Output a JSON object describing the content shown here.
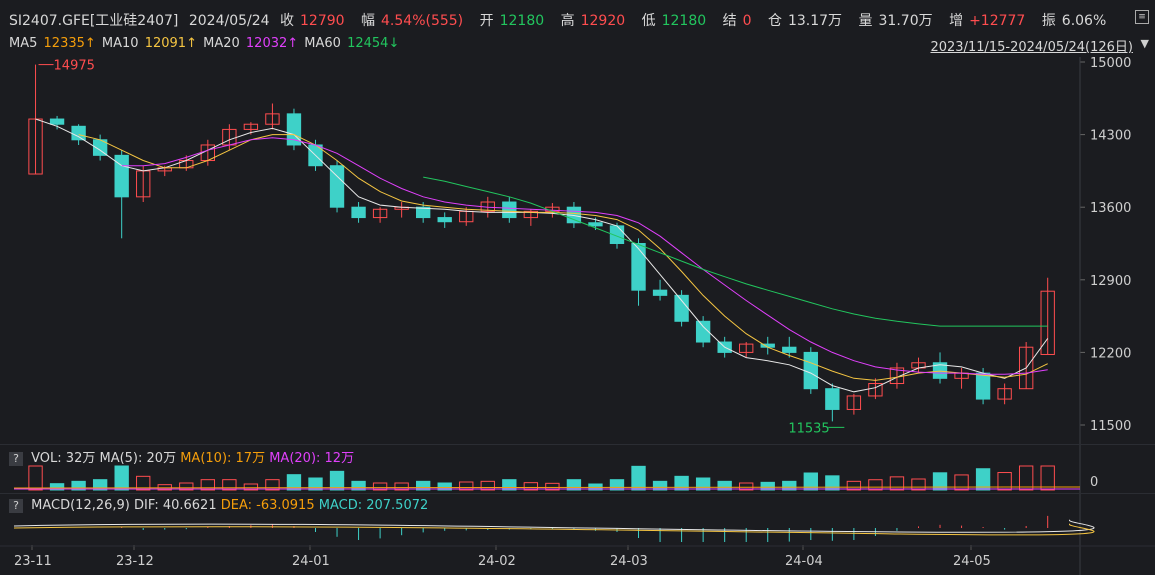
{
  "header": {
    "symbol": "SI2407.GFE[工业硅2407]",
    "date": "2024/05/24",
    "close_label": "收",
    "close": "12790",
    "change_label": "幅",
    "change": "4.54%(555)",
    "open_label": "开",
    "open": "12180",
    "high_label": "高",
    "high": "12920",
    "low_label": "低",
    "low": "12180",
    "settle_label": "结",
    "settle": "0",
    "oi_label": "仓",
    "oi": "13.17万",
    "volume_label": "量",
    "volume": "31.70万",
    "oi_change_label": "增",
    "oi_change": "+12777",
    "amplitude_label": "振",
    "amplitude": "6.06%"
  },
  "ma_row": {
    "ma5_label": "MA5",
    "ma5": "12335↑",
    "ma10_label": "MA10",
    "ma10": "12091↑",
    "ma20_label": "MA20",
    "ma20": "12032↑",
    "ma60_label": "MA60",
    "ma60": "12454↓"
  },
  "date_range": "2023/11/15-2024/05/24(126日)",
  "vol_panel": {
    "help": "?",
    "label": "VOL: 32万",
    "ma5": "MA(5): 20万",
    "ma10": "MA(10): 17万",
    "ma20": "MA(20): 12万",
    "axis_zero": "0"
  },
  "macd_panel": {
    "help": "?",
    "label": "MACD(12,26,9)",
    "dif": "DIF: 40.6621",
    "dea": "DEA: -63.0915",
    "macd": "MACD: 207.5072"
  },
  "annotations": {
    "high": "14975",
    "low": "11535"
  },
  "colors": {
    "up": "#ff4d4f",
    "down": "#3ed1c8",
    "ma5": "#e8e8e8",
    "ma10": "#f5c542",
    "ma20": "#e040fb",
    "ma60": "#22c55e"
  },
  "chart_data": {
    "type": "candlestick",
    "y_ticks": [
      "15000",
      "14300",
      "13600",
      "12900",
      "12200",
      "11500"
    ],
    "x_ticks": [
      "23-11",
      "23-12",
      "24-01",
      "24-02",
      "24-03",
      "24-04",
      "24-05"
    ],
    "ylim": [
      11500,
      15000
    ],
    "series": [
      {
        "name": "MA5",
        "values": [
          14450,
          14380,
          14280,
          14150,
          14000,
          13950,
          13980,
          14050,
          14150,
          14250,
          14320,
          14360,
          14300,
          14100,
          13900,
          13700,
          13620,
          13600,
          13590,
          13580,
          13560,
          13550,
          13550,
          13550,
          13540,
          13520,
          13480,
          13420,
          13200,
          12950,
          12700,
          12450,
          12250,
          12150,
          12120,
          12080,
          12000,
          11880,
          11820,
          11860,
          11960,
          12050,
          12080,
          12060,
          12000,
          11950,
          12050,
          12335
        ]
      },
      {
        "name": "MA10",
        "values": [
          null,
          null,
          14300,
          14250,
          14150,
          14050,
          13980,
          13980,
          14050,
          14150,
          14250,
          14300,
          14300,
          14200,
          14050,
          13880,
          13750,
          13660,
          13620,
          13600,
          13580,
          13570,
          13560,
          13550,
          13550,
          13540,
          13520,
          13480,
          13380,
          13200,
          12980,
          12750,
          12550,
          12380,
          12250,
          12170,
          12100,
          12020,
          11950,
          11930,
          11960,
          12000,
          12020,
          12000,
          11980,
          11960,
          11990,
          12091
        ]
      },
      {
        "name": "MA20",
        "values": [
          null,
          null,
          null,
          null,
          14000,
          14000,
          14020,
          14080,
          14150,
          14200,
          14250,
          14270,
          14250,
          14200,
          14120,
          14000,
          13880,
          13780,
          13700,
          13650,
          13620,
          13600,
          13590,
          13580,
          13570,
          13560,
          13550,
          13520,
          13450,
          13320,
          13160,
          13000,
          12850,
          12700,
          12560,
          12420,
          12300,
          12200,
          12120,
          12060,
          12030,
          12010,
          12000,
          12000,
          11990,
          11990,
          12000,
          12032
        ]
      },
      {
        "name": "MA60",
        "values": [
          null,
          null,
          null,
          null,
          null,
          null,
          null,
          null,
          null,
          null,
          null,
          null,
          null,
          null,
          null,
          null,
          null,
          null,
          13890,
          13850,
          13800,
          13750,
          13700,
          13640,
          13560,
          13480,
          13400,
          13320,
          13240,
          13160,
          13080,
          13000,
          12930,
          12860,
          12800,
          12740,
          12680,
          12620,
          12570,
          12530,
          12500,
          12475,
          12454,
          12454,
          12454,
          12454,
          12454,
          12454
        ]
      }
    ],
    "ohlc": [
      [
        13920,
        14975,
        13920,
        14450
      ],
      [
        14450,
        14480,
        14350,
        14400
      ],
      [
        14380,
        14400,
        14200,
        14250
      ],
      [
        14250,
        14300,
        14050,
        14100
      ],
      [
        14100,
        14150,
        13300,
        13700
      ],
      [
        13700,
        14000,
        13650,
        13950
      ],
      [
        13950,
        14000,
        13900,
        13980
      ],
      [
        13980,
        14100,
        13950,
        14050
      ],
      [
        14050,
        14250,
        14000,
        14200
      ],
      [
        14200,
        14400,
        14150,
        14350
      ],
      [
        14350,
        14420,
        14300,
        14400
      ],
      [
        14400,
        14600,
        14350,
        14500
      ],
      [
        14500,
        14550,
        14150,
        14200
      ],
      [
        14200,
        14250,
        13950,
        14000
      ],
      [
        14000,
        14050,
        13550,
        13600
      ],
      [
        13600,
        13650,
        13450,
        13500
      ],
      [
        13500,
        13600,
        13450,
        13580
      ],
      [
        13580,
        13650,
        13500,
        13600
      ],
      [
        13600,
        13650,
        13450,
        13500
      ],
      [
        13500,
        13550,
        13400,
        13460
      ],
      [
        13460,
        13600,
        13420,
        13560
      ],
      [
        13560,
        13700,
        13500,
        13650
      ],
      [
        13650,
        13700,
        13450,
        13500
      ],
      [
        13500,
        13580,
        13420,
        13560
      ],
      [
        13560,
        13640,
        13500,
        13600
      ],
      [
        13600,
        13650,
        13400,
        13450
      ],
      [
        13450,
        13500,
        13380,
        13420
      ],
      [
        13420,
        13450,
        13200,
        13250
      ],
      [
        13250,
        13300,
        12650,
        12800
      ],
      [
        12800,
        12900,
        12700,
        12750
      ],
      [
        12750,
        12800,
        12450,
        12500
      ],
      [
        12500,
        12550,
        12250,
        12300
      ],
      [
        12300,
        12350,
        12150,
        12200
      ],
      [
        12200,
        12300,
        12150,
        12280
      ],
      [
        12280,
        12350,
        12180,
        12250
      ],
      [
        12250,
        12350,
        12150,
        12200
      ],
      [
        12200,
        12250,
        11800,
        11850
      ],
      [
        11850,
        11900,
        11535,
        11650
      ],
      [
        11650,
        11800,
        11600,
        11780
      ],
      [
        11780,
        11950,
        11750,
        11900
      ],
      [
        11900,
        12100,
        11850,
        12050
      ],
      [
        12050,
        12150,
        12000,
        12100
      ],
      [
        12100,
        12200,
        11900,
        11950
      ],
      [
        11950,
        12050,
        11850,
        12000
      ],
      [
        12000,
        12050,
        11700,
        11750
      ],
      [
        11750,
        11900,
        11700,
        11850
      ],
      [
        11850,
        12300,
        11850,
        12250
      ],
      [
        12180,
        12920,
        12180,
        12790
      ]
    ]
  }
}
